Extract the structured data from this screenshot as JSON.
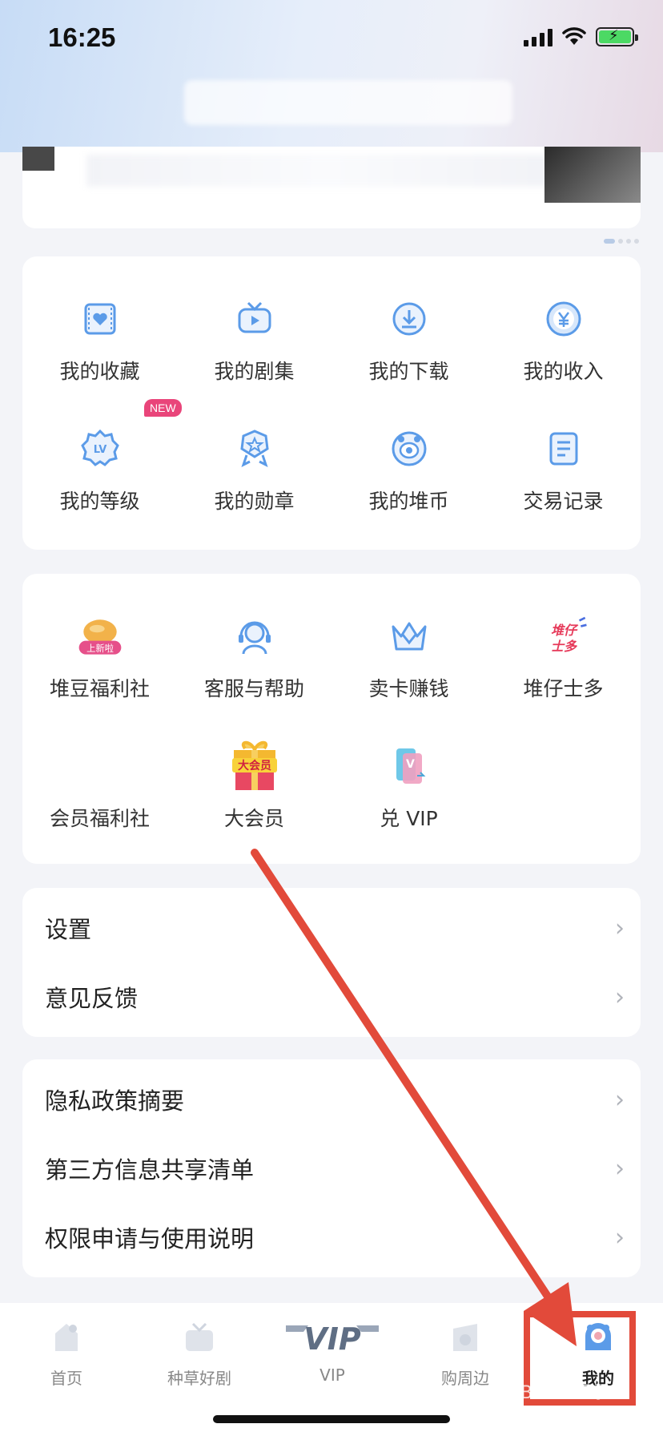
{
  "status": {
    "time": "16:25"
  },
  "grid1": [
    {
      "label": "我的收藏",
      "icon": "film-heart-icon"
    },
    {
      "label": "我的剧集",
      "icon": "tv-play-icon"
    },
    {
      "label": "我的下载",
      "icon": "download-icon"
    },
    {
      "label": "我的收入",
      "icon": "yuan-coin-icon"
    },
    {
      "label": "我的等级",
      "icon": "level-badge-icon",
      "badge": "NEW"
    },
    {
      "label": "我的勋章",
      "icon": "medal-icon"
    },
    {
      "label": "我的堆币",
      "icon": "coin-icon"
    },
    {
      "label": "交易记录",
      "icon": "document-list-icon"
    }
  ],
  "grid2": [
    {
      "label": "堆豆福利社",
      "icon": "bean-icon",
      "tag": "上新啦"
    },
    {
      "label": "客服与帮助",
      "icon": "headset-icon"
    },
    {
      "label": "卖卡赚钱",
      "icon": "crown-icon"
    },
    {
      "label": "堆仔士多",
      "icon": "store-logo-icon",
      "logo_text": "堆仔士多"
    },
    {
      "label": "会员福利社",
      "icon": ""
    },
    {
      "label": "大会员",
      "icon": "gift-box-icon",
      "logo_text": "大会员"
    },
    {
      "label": "兑 VIP",
      "icon": "vip-card-icon"
    }
  ],
  "settings": [
    {
      "label": "设置"
    },
    {
      "label": "意见反馈"
    }
  ],
  "policies": [
    {
      "label": "隐私政策摘要"
    },
    {
      "label": "第三方信息共享清单"
    },
    {
      "label": "权限申请与使用说明"
    }
  ],
  "tabs": [
    {
      "label": "首页",
      "icon": "home-icon"
    },
    {
      "label": "种草好剧",
      "icon": "tv-icon"
    },
    {
      "label": "VIP",
      "icon": "vip-logo-icon",
      "logo_text": "VIP"
    },
    {
      "label": "购周边",
      "icon": "shop-icon"
    },
    {
      "label": "我的",
      "icon": "profile-icon",
      "active": true
    }
  ],
  "colors": {
    "accent_blue": "#5b9be8",
    "highlight_red": "#e24a3a"
  },
  "watermark": "Baidu 经验"
}
